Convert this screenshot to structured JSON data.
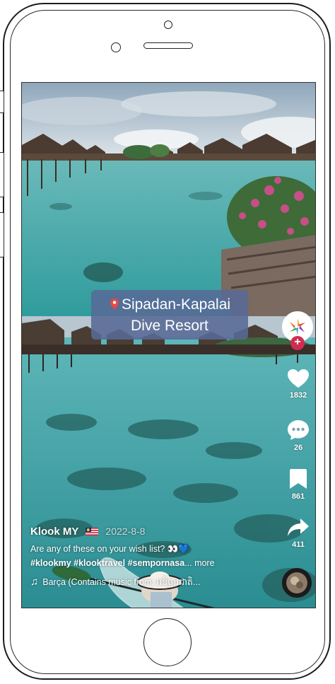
{
  "video": {
    "location_sticker": {
      "line1": "Sipadan-Kapalai",
      "line2": "Dive Resort",
      "icon": "map-pin-icon"
    },
    "author": "Klook MY",
    "author_flag": "malaysia-flag-icon",
    "date": "2022-8-8",
    "caption": "Are any of these on your wish list? 👀💙",
    "hashtags": "#klookmy #klooktravel #sempornasa",
    "more_label": "... more",
    "music": "Barça (Contains music from: អនិច្ចារជាតិ...",
    "music_icon": "music-note-icon"
  },
  "actions": {
    "likes": "1832",
    "comments": "26",
    "saves": "861",
    "shares": "411",
    "follow_symbol": "+"
  },
  "colors": {
    "like_red": "#ce2d52",
    "sticker_bg": "#586a96",
    "water": "#3aa5a5"
  }
}
